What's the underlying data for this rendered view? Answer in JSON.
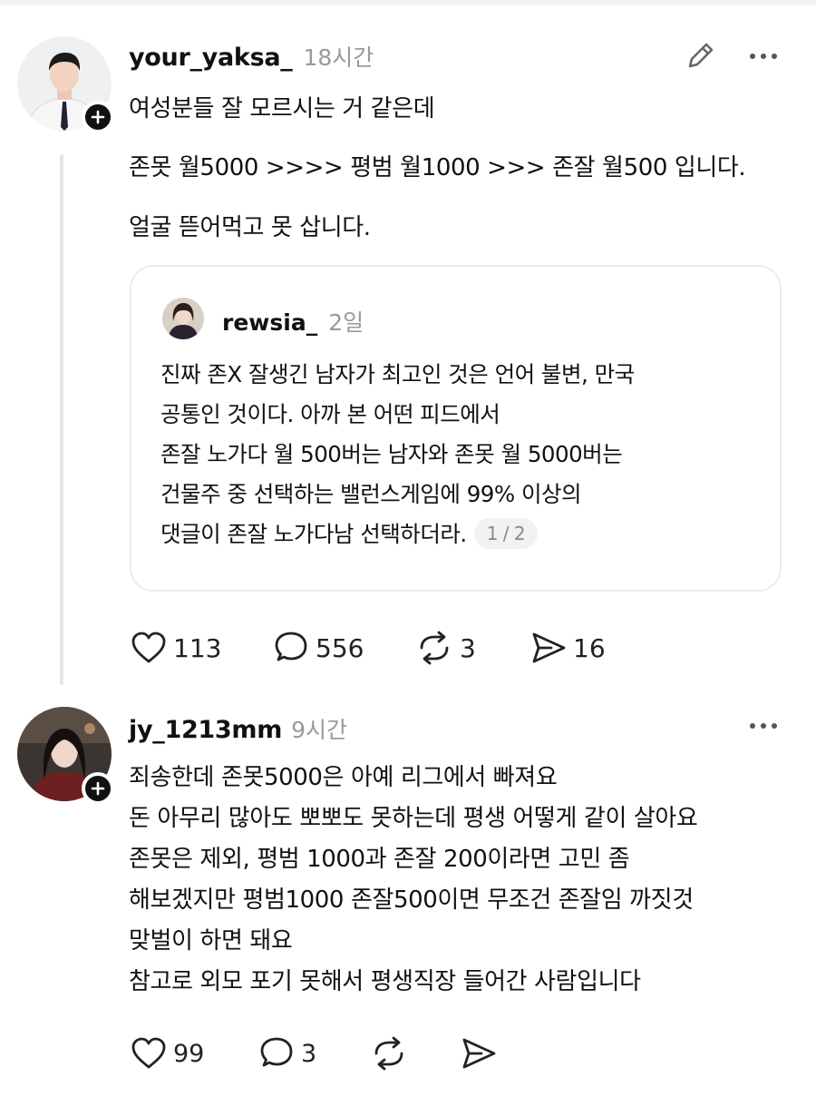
{
  "posts": [
    {
      "username": "your_yaksa_",
      "time": "18시간",
      "lines": [
        "여성분들 잘 모르시는 거 같은데",
        "존못 월5000 >>>> 평범 월1000 >>> 존잘 월500 입니다.",
        "얼굴 뜯어먹고 못 삽니다."
      ],
      "quote": {
        "username": "rewsia_",
        "time": "2일",
        "lines": [
          "진짜 존X 잘생긴 남자가 최고인 것은 언어 불변, 만국",
          "공통인 것이다. 아까 본 어떤 피드에서",
          "존잘 노가다 월 500버는 남자와 존못 월 5000버는",
          "건물주 중 선택하는 밸런스게임에 99% 이상의",
          "댓글이 존잘 노가다남 선택하더라."
        ],
        "page": "1 / 2"
      },
      "actions": {
        "likes": "113",
        "comments": "556",
        "reposts": "3",
        "shares": "16"
      }
    },
    {
      "username": "jy_1213mm",
      "time": "9시간",
      "lines": [
        "죄송한데 존못5000은 아예 리그에서 빠져요",
        "돈 아무리 많아도 뽀뽀도 못하는데 평생 어떻게 같이 살아요",
        "존못은 제외, 평범 1000과 존잘 200이라면 고민 좀",
        "해보겠지만 평범1000 존잘500이면 무조건 존잘임 까짓것",
        "맞벌이 하면 돼요",
        "참고로 외모 포기 못해서 평생직장 들어간 사람입니다"
      ],
      "actions": {
        "likes": "99",
        "comments": "3"
      }
    }
  ],
  "icons": {
    "edit": "pencil-icon",
    "more": "more-dots-icon",
    "like": "heart-icon",
    "comment": "comment-bubble-icon",
    "repost": "repost-icon",
    "share": "send-icon",
    "follow": "plus-icon"
  },
  "colors": {
    "text": "#111111",
    "muted": "#9a9a9a",
    "border": "#ececec"
  }
}
